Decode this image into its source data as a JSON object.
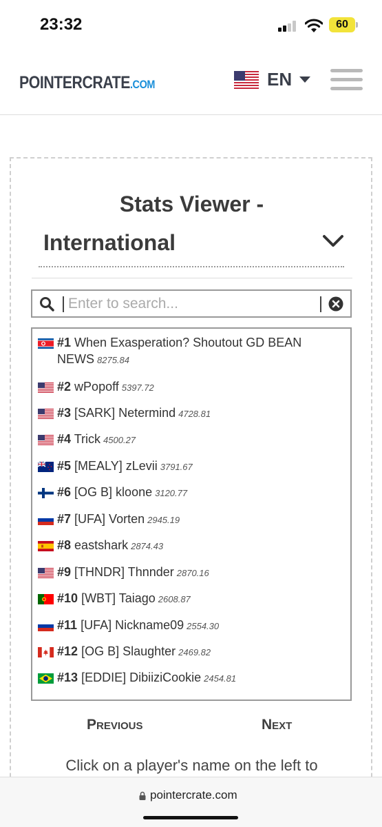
{
  "status_bar": {
    "time": "23:32",
    "battery": "60"
  },
  "nav": {
    "brand_main": "POINTERCRATE",
    "brand_tld": ".COM",
    "language": "EN"
  },
  "viewer": {
    "title": "Stats Viewer -",
    "region": "International",
    "search_placeholder": "Enter to search..."
  },
  "players": [
    {
      "rank": "#1",
      "name": "When Exasperation? Shoutout GD BEAN NEWS",
      "score": "8275.84",
      "flag": "north-korea"
    },
    {
      "rank": "#2",
      "name": "wPopoff",
      "score": "5397.72",
      "flag": "usa"
    },
    {
      "rank": "#3",
      "name": "[SARK] Netermind",
      "score": "4728.81",
      "flag": "usa"
    },
    {
      "rank": "#4",
      "name": "Trick",
      "score": "4500.27",
      "flag": "usa"
    },
    {
      "rank": "#5",
      "name": "[MEALY] zLevii",
      "score": "3791.67",
      "flag": "new-zealand"
    },
    {
      "rank": "#6",
      "name": "[OG B] kloone",
      "score": "3120.77",
      "flag": "finland"
    },
    {
      "rank": "#7",
      "name": "[UFA] Vorten",
      "score": "2945.19",
      "flag": "russia"
    },
    {
      "rank": "#8",
      "name": "eastshark",
      "score": "2874.43",
      "flag": "spain"
    },
    {
      "rank": "#9",
      "name": "[THNDR] Thnnder",
      "score": "2870.16",
      "flag": "usa"
    },
    {
      "rank": "#10",
      "name": "[WBT] Taiago",
      "score": "2608.87",
      "flag": "portugal"
    },
    {
      "rank": "#11",
      "name": "[UFA] Nickname09",
      "score": "2554.30",
      "flag": "russia"
    },
    {
      "rank": "#12",
      "name": "[OG B] Slaughter",
      "score": "2469.82",
      "flag": "canada"
    },
    {
      "rank": "#13",
      "name": "[EDDIE] DibiiziCookie",
      "score": "2454.81",
      "flag": "brazil"
    }
  ],
  "pagination": {
    "previous": "Previous",
    "next": "Next"
  },
  "hint": "Click on a player's name on the left to",
  "browser": {
    "url": "pointercrate.com"
  },
  "colors": {
    "brand_tld": "#1a8fd9",
    "battery": "#f2e33a"
  }
}
